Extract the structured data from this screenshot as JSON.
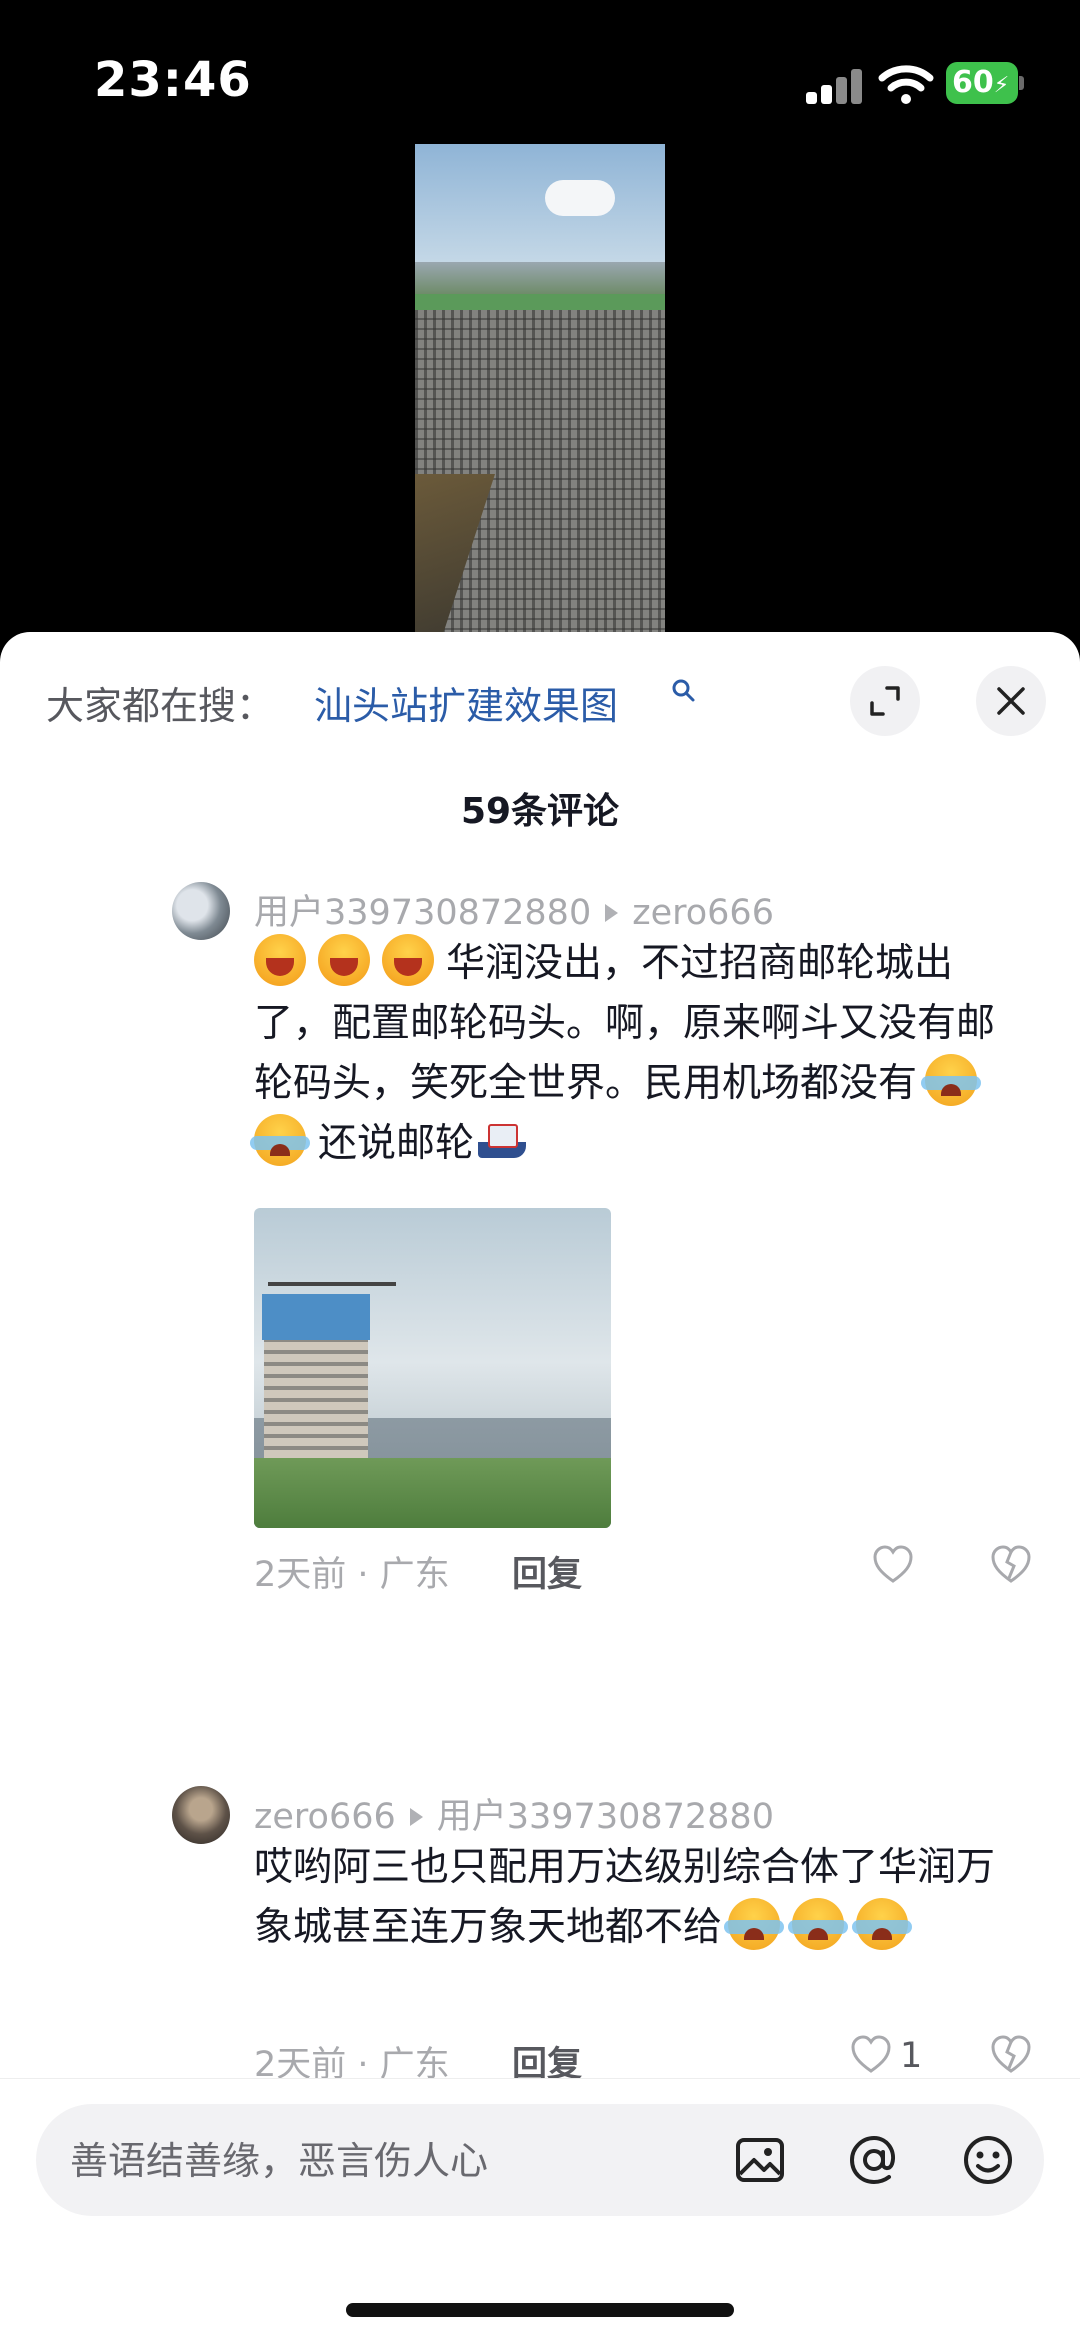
{
  "status_bar": {
    "time": "23:46",
    "battery": "60"
  },
  "search_suggestion": {
    "prefix": "大家都在搜：",
    "term": "汕头站扩建效果图"
  },
  "comment_count": "59条评论",
  "comments": [
    {
      "author": "用户339730872880",
      "reply_to": "zero666",
      "text_1": "华润没出，不过招商邮轮城出了，配置邮轮码头。啊，原来啊斗又没有邮轮码头，笑死全世界。民用机场都没有",
      "text_2": "还说邮轮",
      "time_location": "2天前 · 广东",
      "reply_label": "回复"
    },
    {
      "author": "zero666",
      "reply_to": "用户339730872880",
      "text_1": "哎哟阿三也只配用万达级别综合体了华润万象城甚至连万象天地都不给",
      "time_location": "2天前 · 广东",
      "reply_label": "回复",
      "like_count": "1"
    }
  ],
  "input": {
    "placeholder": "善语结善缘，恶言伤人心"
  }
}
